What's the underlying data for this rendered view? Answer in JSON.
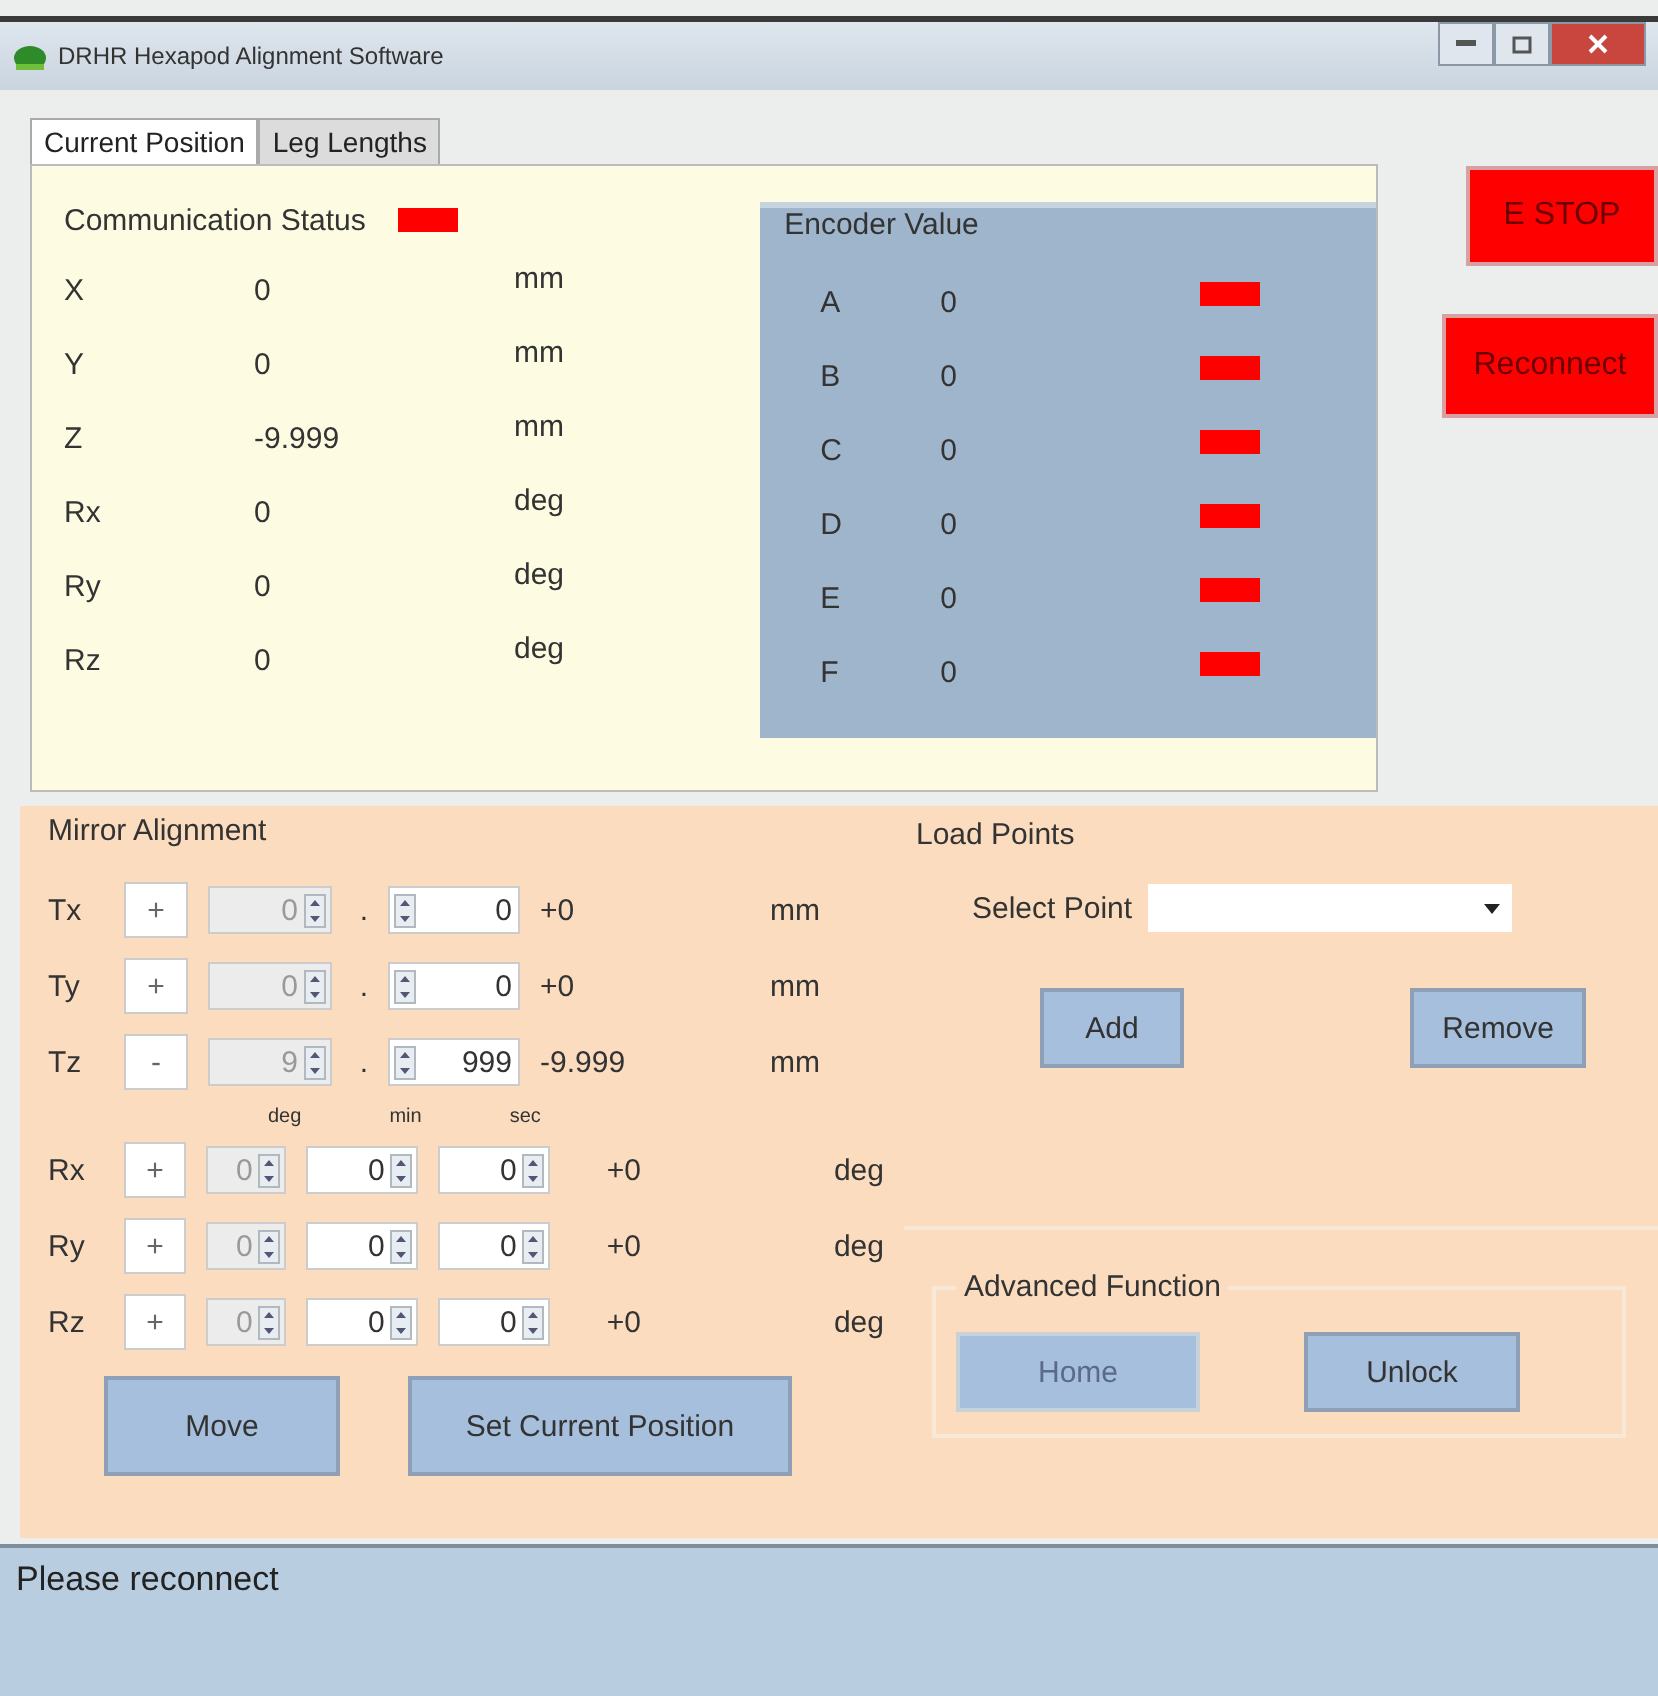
{
  "window": {
    "title": "DRHR Hexapod Alignment Software"
  },
  "tabs": [
    {
      "label": "Current Position",
      "selected": true
    },
    {
      "label": "Leg Lengths",
      "selected": false
    }
  ],
  "communication": {
    "label": "Communication Status",
    "ok": false
  },
  "position": [
    {
      "axis": "X",
      "value": "0",
      "unit": "mm"
    },
    {
      "axis": "Y",
      "value": "0",
      "unit": "mm"
    },
    {
      "axis": "Z",
      "value": "-9.999",
      "unit": "mm"
    },
    {
      "axis": "Rx",
      "value": "0",
      "unit": "deg"
    },
    {
      "axis": "Ry",
      "value": "0",
      "unit": "deg"
    },
    {
      "axis": "Rz",
      "value": "0",
      "unit": "deg"
    }
  ],
  "encoder": {
    "title": "Encoder Value",
    "rows": [
      {
        "name": "A",
        "value": "0",
        "ok": false
      },
      {
        "name": "B",
        "value": "0",
        "ok": false
      },
      {
        "name": "C",
        "value": "0",
        "ok": false
      },
      {
        "name": "D",
        "value": "0",
        "ok": false
      },
      {
        "name": "E",
        "value": "0",
        "ok": false
      },
      {
        "name": "F",
        "value": "0",
        "ok": false
      }
    ]
  },
  "side_buttons": [
    {
      "label": "E STOP"
    },
    {
      "label": "Reconnect"
    }
  ],
  "mirror": {
    "title": "Mirror Alignment",
    "translation": [
      {
        "axis": "Tx",
        "sign": "+",
        "whole": {
          "value": "0",
          "disabled": true
        },
        "separator": ".",
        "fraction": {
          "value": "0",
          "disabled": false
        },
        "result": "+0",
        "unit": "mm"
      },
      {
        "axis": "Ty",
        "sign": "+",
        "whole": {
          "value": "0",
          "disabled": true
        },
        "separator": ".",
        "fraction": {
          "value": "0",
          "disabled": false
        },
        "result": "+0",
        "unit": "mm"
      },
      {
        "axis": "Tz",
        "sign": "-",
        "whole": {
          "value": "9",
          "disabled": true
        },
        "separator": ".",
        "fraction": {
          "value": "999",
          "disabled": false
        },
        "result": "-9.999",
        "unit": "mm"
      }
    ],
    "angle_headers": [
      "deg",
      "min",
      "sec"
    ],
    "rotation": [
      {
        "axis": "Rx",
        "sign": "+",
        "fields": [
          {
            "value": "0",
            "disabled": true
          },
          {
            "value": "0",
            "disabled": false
          },
          {
            "value": "0",
            "disabled": false
          }
        ],
        "result": "+0",
        "unit": "deg"
      },
      {
        "axis": "Ry",
        "sign": "+",
        "fields": [
          {
            "value": "0",
            "disabled": true
          },
          {
            "value": "0",
            "disabled": false
          },
          {
            "value": "0",
            "disabled": false
          }
        ],
        "result": "+0",
        "unit": "deg"
      },
      {
        "axis": "Rz",
        "sign": "+",
        "fields": [
          {
            "value": "0",
            "disabled": true
          },
          {
            "value": "0",
            "disabled": false
          },
          {
            "value": "0",
            "disabled": false
          }
        ],
        "result": "+0",
        "unit": "deg"
      }
    ],
    "buttons": [
      {
        "label": "Move"
      },
      {
        "label": "Set Current Position"
      }
    ]
  },
  "load_points": {
    "title": "Load Points",
    "select_label": "Select Point",
    "buttons": [
      {
        "label": "Add"
      },
      {
        "label": "Remove"
      }
    ]
  },
  "advanced": {
    "title": "Advanced Function",
    "buttons": [
      {
        "label": "Home",
        "disabled": true
      },
      {
        "label": "Unlock",
        "disabled": false
      }
    ]
  },
  "status": {
    "message": "Please reconnect"
  }
}
